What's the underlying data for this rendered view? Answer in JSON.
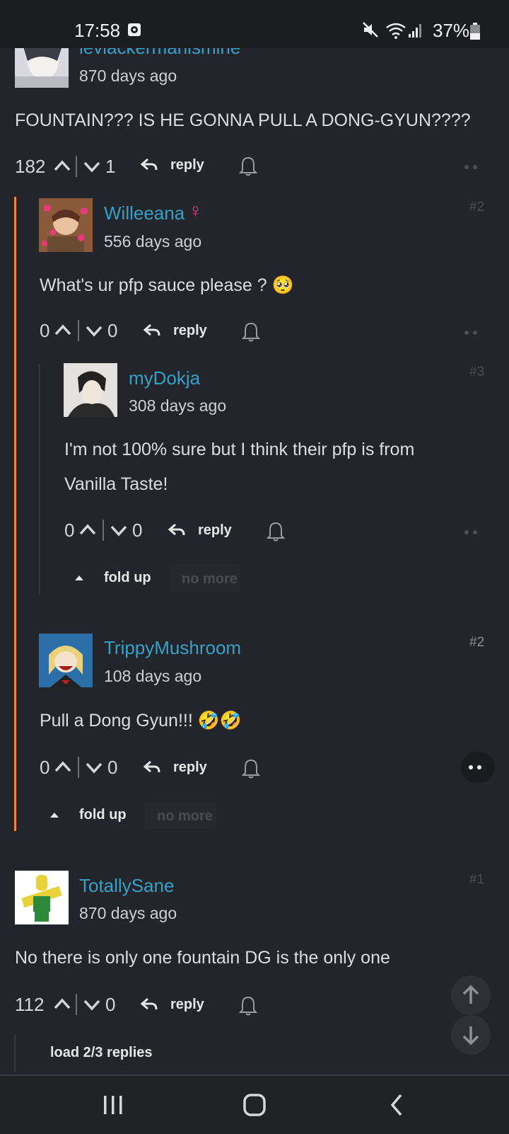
{
  "status": {
    "time": "17:58",
    "battery": "37%"
  },
  "comments": [
    {
      "username": "leviackermanismine",
      "time": "870 days ago",
      "text": "FOUNTAIN??? IS HE GONNA PULL A DONG-GYUN????",
      "up": "182",
      "down": "1",
      "reply": "reply"
    },
    {
      "username": "Willeeana",
      "gender": "♀",
      "time": "556 days ago",
      "text": "What's ur pfp sauce please ? 🥺",
      "up": "0",
      "down": "0",
      "reply": "reply",
      "index": "#2"
    },
    {
      "username": "myDokja",
      "time": "308 days ago",
      "text1": "I'm not 100% sure but I think their pfp is from",
      "text2": "Vanilla Taste!",
      "up": "0",
      "down": "0",
      "reply": "reply",
      "index": "#3"
    },
    {
      "username": "TrippyMushroom",
      "time": "108 days ago",
      "text": "Pull a Dong Gyun!!! 🤣🤣",
      "up": "0",
      "down": "0",
      "reply": "reply",
      "index": "#2"
    },
    {
      "username": "TotallySane",
      "time": "870 days ago",
      "text": "No there is only one fountain DG is the only one",
      "up": "112",
      "down": "0",
      "reply": "reply",
      "index": "#1"
    }
  ],
  "fold": {
    "fold_up": "fold up",
    "no_more": "no more",
    "load_replies": "load 2/3 replies"
  },
  "colors": {
    "background": "#23252a",
    "username": "#34a2c8",
    "thread_line": "#f0883a",
    "gender": "#e23a8e"
  }
}
